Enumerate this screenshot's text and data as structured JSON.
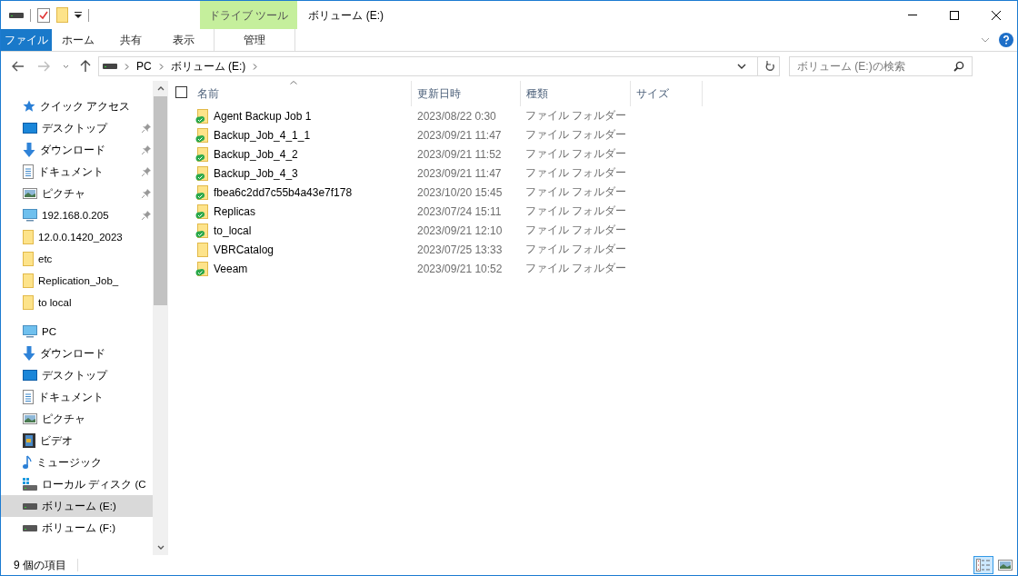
{
  "window": {
    "title": "ボリューム (E:)"
  },
  "quick_toolbar": [
    {
      "kind": "drive"
    },
    {
      "kind": "properties"
    },
    {
      "kind": "folder"
    },
    {
      "kind": "customize"
    }
  ],
  "ribbon": {
    "context_header": "ドライブ ツール",
    "tabs": [
      {
        "label": "ファイル",
        "kind": "file",
        "selected": false
      },
      {
        "label": "ホーム",
        "kind": "normal",
        "selected": false
      },
      {
        "label": "共有",
        "kind": "normal",
        "selected": false
      },
      {
        "label": "表示",
        "kind": "normal",
        "selected": false
      },
      {
        "label": "管理",
        "kind": "context",
        "selected": false
      }
    ]
  },
  "address": {
    "crumbs": [
      "PC",
      "ボリューム (E:)"
    ]
  },
  "search": {
    "placeholder": "ボリューム (E:)の検索"
  },
  "sidebar": {
    "sections": [
      {
        "label": "クイック アクセス",
        "kind": "star",
        "selected": false,
        "children": [
          {
            "label": "デスクトップ",
            "kind": "desktop",
            "pinned": true,
            "selected": false
          },
          {
            "label": "ダウンロード",
            "kind": "download",
            "pinned": true,
            "selected": false
          },
          {
            "label": "ドキュメント",
            "kind": "document",
            "pinned": true,
            "selected": false
          },
          {
            "label": "ピクチャ",
            "kind": "picture",
            "pinned": true,
            "selected": false
          },
          {
            "label": "192.168.0.205",
            "kind": "monitor",
            "pinned": true,
            "selected": false
          },
          {
            "label": "12.0.0.1420_2023",
            "kind": "folder",
            "pinned": false,
            "selected": false
          },
          {
            "label": "etc",
            "kind": "folder",
            "pinned": false,
            "selected": false
          },
          {
            "label": "Replication_Job_",
            "kind": "folder",
            "pinned": false,
            "selected": false
          },
          {
            "label": "to local",
            "kind": "folder",
            "pinned": false,
            "selected": false
          }
        ]
      },
      {
        "label": "PC",
        "kind": "monitor",
        "selected": false,
        "children": [
          {
            "label": "ダウンロード",
            "kind": "download",
            "pinned": false,
            "selected": false
          },
          {
            "label": "デスクトップ",
            "kind": "desktop",
            "pinned": false,
            "selected": false
          },
          {
            "label": "ドキュメント",
            "kind": "document",
            "pinned": false,
            "selected": false
          },
          {
            "label": "ピクチャ",
            "kind": "picture",
            "pinned": false,
            "selected": false
          },
          {
            "label": "ビデオ",
            "kind": "video",
            "pinned": false,
            "selected": false
          },
          {
            "label": "ミュージック",
            "kind": "music",
            "pinned": false,
            "selected": false
          },
          {
            "label": "ローカル ディスク (C",
            "kind": "system-drive",
            "pinned": false,
            "selected": false
          },
          {
            "label": "ボリューム (E:)",
            "kind": "drive",
            "pinned": false,
            "selected": true
          },
          {
            "label": "ボリューム (F:)",
            "kind": "drive",
            "pinned": false,
            "selected": false
          }
        ]
      }
    ]
  },
  "table": {
    "select_all": {
      "checked": false
    },
    "columns": [
      "名前",
      "更新日時",
      "種類",
      "サイズ"
    ],
    "rows": [
      {
        "name": "Agent Backup Job 1",
        "modified": "2023/08/22 0:30",
        "type": "ファイル フォルダー",
        "synced": true
      },
      {
        "name": "Backup_Job_4_1_1",
        "modified": "2023/09/21 11:47",
        "type": "ファイル フォルダー",
        "synced": true
      },
      {
        "name": "Backup_Job_4_2",
        "modified": "2023/09/21 11:52",
        "type": "ファイル フォルダー",
        "synced": true
      },
      {
        "name": "Backup_Job_4_3",
        "modified": "2023/09/21 11:47",
        "type": "ファイル フォルダー",
        "synced": true
      },
      {
        "name": "fbea6c2dd7c55b4a43e7f178",
        "modified": "2023/10/20 15:45",
        "type": "ファイル フォルダー",
        "synced": true
      },
      {
        "name": "Replicas",
        "modified": "2023/07/24 15:11",
        "type": "ファイル フォルダー",
        "synced": true
      },
      {
        "name": "to_local",
        "modified": "2023/09/21 12:10",
        "type": "ファイル フォルダー",
        "synced": true
      },
      {
        "name": "VBRCatalog",
        "modified": "2023/07/25 13:33",
        "type": "ファイル フォルダー",
        "synced": false
      },
      {
        "name": "Veeam",
        "modified": "2023/09/21 10:52",
        "type": "ファイル フォルダー",
        "synced": true
      }
    ]
  },
  "status_bar": {
    "item_count": "9 個の項目",
    "views": [
      {
        "kind": "details",
        "selected": true
      },
      {
        "kind": "large-icons",
        "selected": false
      }
    ]
  }
}
